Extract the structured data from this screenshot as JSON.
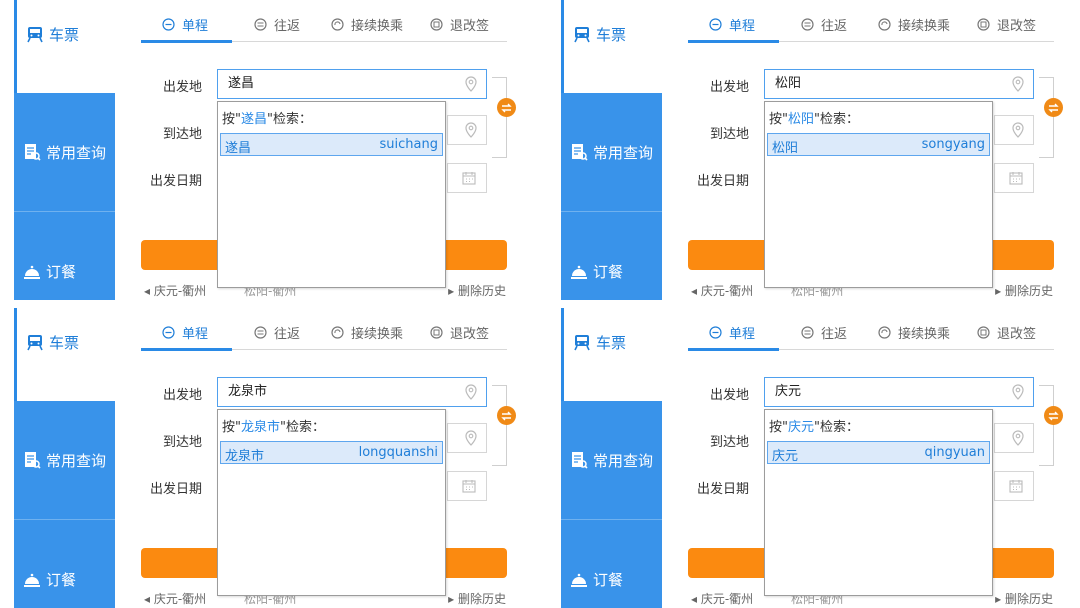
{
  "sidebar": {
    "tickets": "车票",
    "common_query": "常用查询",
    "meal": "订餐"
  },
  "tabs": [
    "单程",
    "往返",
    "接续换乘",
    "退改签"
  ],
  "form": {
    "from_label": "出发地",
    "to_label": "到达地",
    "date_label": "出发日期"
  },
  "history": {
    "item1": "庆元-衢州",
    "item2": "松阳-衢州",
    "delete": "删除历史"
  },
  "dropdown": {
    "prefix": "按\"",
    "suffix": "\"检索："
  },
  "panels": [
    {
      "input": "遂昌",
      "result_cn": "遂昌",
      "result_py": "suichang"
    },
    {
      "input": "松阳",
      "result_cn": "松阳",
      "result_py": "songyang"
    },
    {
      "input": "龙泉市",
      "result_cn": "龙泉市",
      "result_py": "longquanshi"
    },
    {
      "input": "庆元",
      "result_cn": "庆元",
      "result_py": "qingyuan"
    }
  ],
  "colors": {
    "accent": "#2a8ae6",
    "sidebar_blue": "#3993ea",
    "orange": "#fb8a10"
  }
}
